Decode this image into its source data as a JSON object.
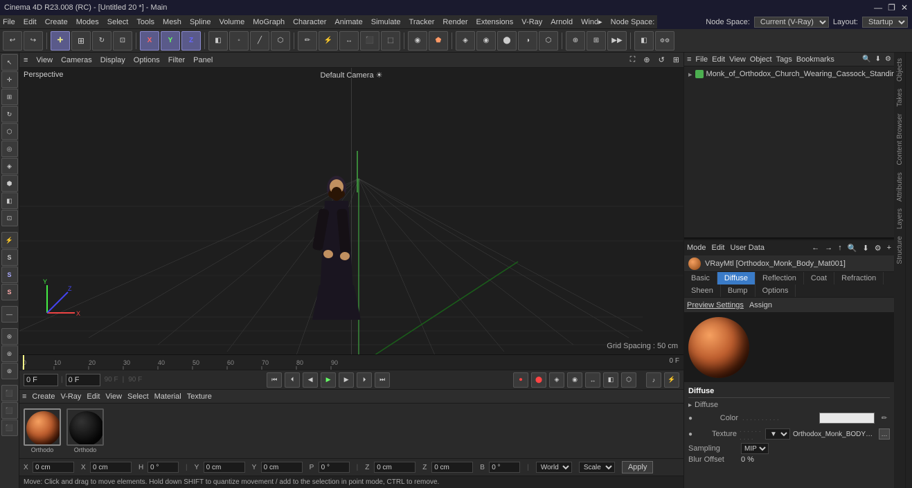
{
  "titlebar": {
    "title": "Cinema 4D R23.008 (RC) - [Untitled 20 *] - Main",
    "min": "—",
    "max": "❐",
    "close": "✕"
  },
  "menubar": {
    "items": [
      "File",
      "Edit",
      "Create",
      "Modes",
      "Select",
      "Tools",
      "Mesh",
      "Spline",
      "Volume",
      "MoGraph",
      "Character",
      "Animate",
      "Simulate",
      "Tracker",
      "Render",
      "Extensions",
      "V-Ray",
      "Arnold",
      "Wind",
      "Node Space:"
    ]
  },
  "nodespace": {
    "label": "Node Space:",
    "current": "Current (V-Ray)",
    "layout_label": "Layout:",
    "layout": "Startup"
  },
  "toolbar": {
    "undo": "↩",
    "redo": "↪",
    "move": "✛",
    "scale": "⊞",
    "rotate": "↻",
    "x_axis": "X",
    "y_axis": "Y",
    "z_axis": "Z"
  },
  "viewport": {
    "label_perspective": "Perspective",
    "label_camera": "Default Camera ☀",
    "grid_spacing": "Grid Spacing : 50 cm",
    "header_items": [
      "≡",
      "View",
      "Cameras",
      "Display",
      "Options",
      "Filter",
      "Panel"
    ]
  },
  "timeline": {
    "toolbar_items": [
      "≡",
      "Create",
      "V-Ray",
      "Edit",
      "View",
      "Select",
      "Material",
      "Texture"
    ],
    "frame_start": "0 F",
    "frame_end": "90 F",
    "frame_step": "90 F",
    "current_frame": "0 F",
    "end_frame_display": "0 F",
    "ticks": [
      "0",
      "10",
      "20",
      "30",
      "40",
      "50",
      "60",
      "70",
      "80",
      "90"
    ],
    "frame_input_1": "0 F",
    "frame_input_2": "0 F",
    "frame_input_3": "90 F",
    "frame_input_4": "90 F"
  },
  "coordinates": {
    "x1": "0 cm",
    "y1": "0 cm",
    "z1": "0 cm",
    "x2": "0 cm",
    "y2": "0 cm",
    "z2": "0 cm",
    "h": "0 °",
    "p": "0 °",
    "b": "0 °",
    "world": "World",
    "scale": "Scale",
    "apply": "Apply"
  },
  "statusbar": {
    "text": "Move: Click and drag to move elements. Hold down SHIFT to quantize movement / add to the selection in point mode, CTRL to remove."
  },
  "objects_panel": {
    "toolbar_items": [
      "≡",
      "File",
      "Edit",
      "View",
      "Object",
      "Tags",
      "Bookmarks"
    ],
    "object_name": "Monk_of_Orthodox_Church_Wearing_Cassock_Standing_group",
    "object_color": "#4caf50"
  },
  "side_vtabs": [
    "Objects",
    "Takes",
    "Content Browser",
    "Attributes",
    "Layers",
    "Structure"
  ],
  "attr_panel": {
    "toolbar_items": [
      "Mode",
      "Edit",
      "User Data"
    ],
    "nav_back": "←",
    "nav_forward": "→",
    "material_name": "VRayMtl [Orthodox_Monk_Body_Mat001]",
    "tabs": [
      "Basic",
      "Diffuse",
      "Reflection",
      "Coat",
      "Refraction",
      "Sheen",
      "Bump",
      "Options"
    ],
    "active_tab": "Diffuse",
    "preview_settings": [
      "Preview Settings",
      "Assign"
    ],
    "diffuse": {
      "title": "Diffuse",
      "color_label": "Color",
      "color_dots": ". . . . . . . . . .",
      "texture_label": "Texture",
      "texture_dots": ". . . . . . . . . .",
      "texture_name": "Orthodox_Monk_BODY_Bas",
      "sampling_label": "Sampling",
      "sampling_value": "MIP",
      "blur_label": "Blur Offset",
      "blur_value": "0 %"
    }
  },
  "materials": [
    {
      "name": "Orthodo",
      "type": "body"
    },
    {
      "name": "Orthodo",
      "type": "dark"
    }
  ]
}
